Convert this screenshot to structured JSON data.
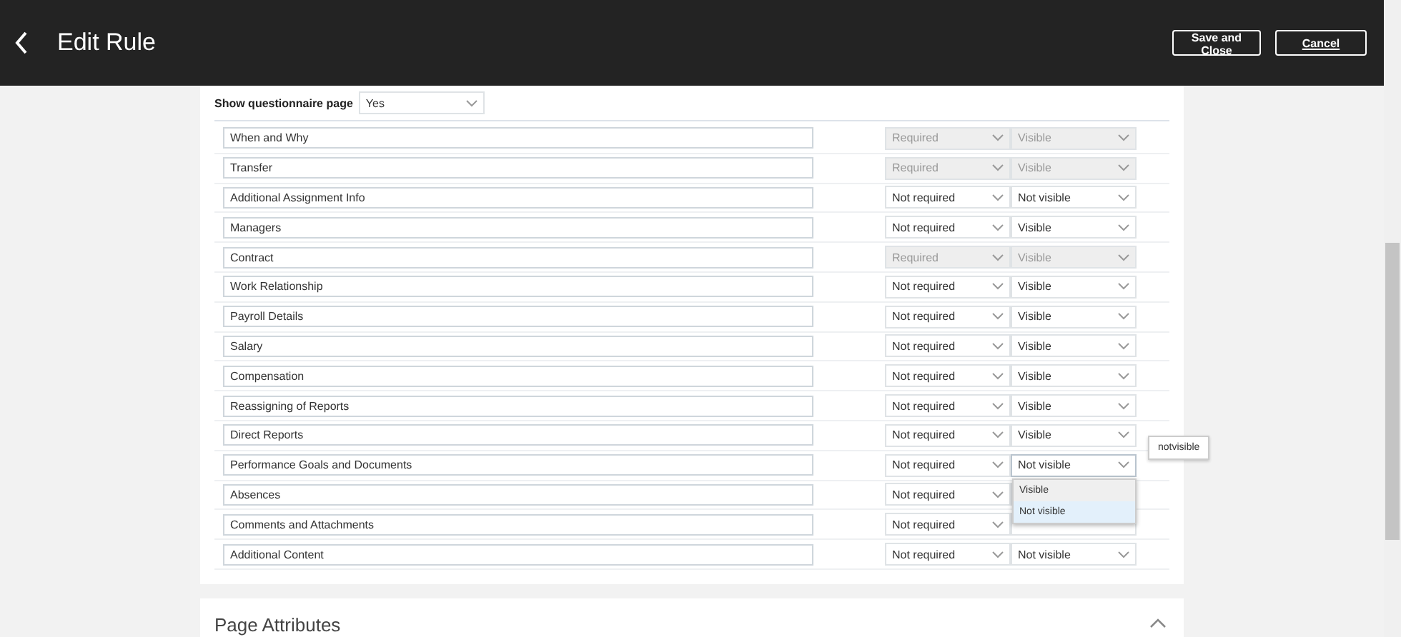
{
  "header": {
    "title": "Edit Rule",
    "buttons": [
      "Save and Close",
      "Cancel"
    ]
  },
  "questionnaire": {
    "label": "Show questionnaire page",
    "value": "Yes"
  },
  "rows": [
    {
      "name": "When and Why",
      "required": "Required",
      "visibility": "Visible",
      "disabled": true
    },
    {
      "name": "Transfer",
      "required": "Required",
      "visibility": "Visible",
      "disabled": true
    },
    {
      "name": "Additional Assignment Info",
      "required": "Not required",
      "visibility": "Not visible",
      "disabled": false
    },
    {
      "name": "Managers",
      "required": "Not required",
      "visibility": "Visible",
      "disabled": false
    },
    {
      "name": "Contract",
      "required": "Required",
      "visibility": "Visible",
      "disabled": true
    },
    {
      "name": "Work Relationship",
      "required": "Not required",
      "visibility": "Visible",
      "disabled": false
    },
    {
      "name": "Payroll Details",
      "required": "Not required",
      "visibility": "Visible",
      "disabled": false
    },
    {
      "name": "Salary",
      "required": "Not required",
      "visibility": "Visible",
      "disabled": false
    },
    {
      "name": "Compensation",
      "required": "Not required",
      "visibility": "Visible",
      "disabled": false
    },
    {
      "name": "Reassigning of Reports",
      "required": "Not required",
      "visibility": "Visible",
      "disabled": false
    },
    {
      "name": "Direct Reports",
      "required": "Not required",
      "visibility": "Visible",
      "disabled": false
    },
    {
      "name": "Performance Goals and Documents",
      "required": "Not required",
      "visibility": "Not visible",
      "disabled": false,
      "open": true,
      "tooltip": "notvisible"
    },
    {
      "name": "Absences",
      "required": "Not required",
      "disabled": false
    },
    {
      "name": "Comments and Attachments",
      "required": "Not required",
      "disabled": false
    },
    {
      "name": "Additional Content",
      "required": "Not required",
      "visibility": "Not visible",
      "disabled": false
    }
  ],
  "dropdown_options": [
    {
      "label": "Visible",
      "selected": false
    },
    {
      "label": "Not visible",
      "selected": true
    }
  ],
  "section": {
    "title": "Page Attributes",
    "expanded": true
  }
}
